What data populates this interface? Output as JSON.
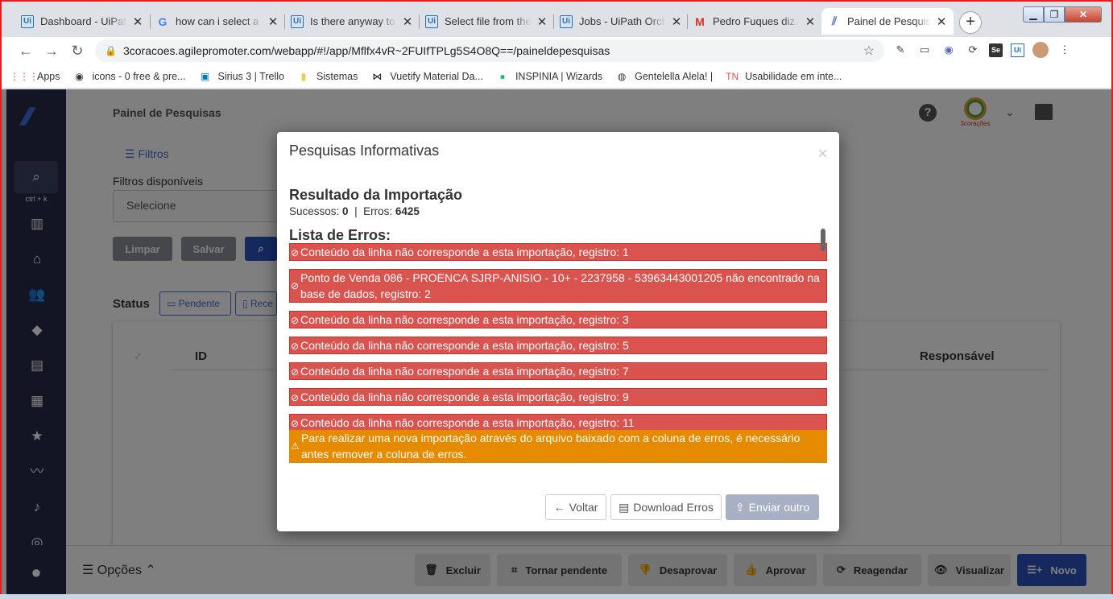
{
  "browser": {
    "tabs": [
      {
        "title": "Dashboard - UiPath",
        "icon": "uipath-icon",
        "fav": "Ui"
      },
      {
        "title": "how can i select a s",
        "icon": "google-icon",
        "fav": "G"
      },
      {
        "title": "Is there anyway to",
        "icon": "uipath-icon",
        "fav": "Ui"
      },
      {
        "title": "Select file from the",
        "icon": "uipath-icon",
        "fav": "Ui"
      },
      {
        "title": "Jobs - UiPath Orche",
        "icon": "uipath-icon",
        "fav": "Ui"
      },
      {
        "title": "Pedro Fuques diz...",
        "icon": "gmail-icon",
        "fav": "M"
      },
      {
        "title": "Painel de Pesquisas",
        "icon": "app-icon",
        "fav": "⫽"
      }
    ],
    "url": "3coracoes.agilepromoter.com/webapp/#!/app/Mflfx4vR~2FUIfTPLg5S4O8Q==/paineldepesquisas",
    "bookmarks": [
      {
        "label": "Apps",
        "icon": "apps-grid-icon",
        "glyph": "⋮⋮⋮"
      },
      {
        "label": "icons - 0 free & pre...",
        "icon": "icons-site-icon",
        "glyph": "◉"
      },
      {
        "label": "Sirius 3 | Trello",
        "icon": "trello-icon",
        "glyph": "▣"
      },
      {
        "label": "Sistemas",
        "icon": "folder-icon",
        "glyph": "▮"
      },
      {
        "label": "Vuetify Material Da...",
        "icon": "bowtie-icon",
        "glyph": "⋈"
      },
      {
        "label": "INSPINIA | Wizards",
        "icon": "inspinia-icon",
        "glyph": "●"
      },
      {
        "label": "Gentelella Alela! |",
        "icon": "gentelella-icon",
        "glyph": "◍"
      },
      {
        "label": "Usabilidade em inte...",
        "icon": "tn-icon",
        "glyph": "TN"
      }
    ]
  },
  "app": {
    "page_title": "Painel de Pesquisas",
    "shortcut_hint": "ctrl + k",
    "brand": "3corações",
    "filters_label": "Filtros",
    "filters_available_label": "Filtros disponíveis",
    "select_placeholder": "Selecione",
    "clear_label": "Limpar",
    "save_label": "Salvar",
    "status_label": "Status",
    "status_chips": [
      "Pendente",
      "Rece"
    ],
    "table_headers": {
      "id": "ID",
      "owner": "Responsável"
    },
    "options_label": "Opções",
    "actions": [
      "Excluir",
      "Tornar pendente",
      "Desaprovar",
      "Aprovar",
      "Reagendar",
      "Visualizar",
      "Novo"
    ]
  },
  "modal": {
    "title": "Pesquisas Informativas",
    "result_title": "Resultado da Importação",
    "success_label": "Sucessos:",
    "success_count": "0",
    "errors_label": "Erros:",
    "errors_count": "6425",
    "list_title": "Lista de Erros:",
    "errors": [
      "Conteúdo da linha não corresponde a esta importação, registro: 1",
      "Ponto de Venda 086 - PROENCA SJRP-ANISIO - 10+ - 2237958 - 53963443001205 não encontrado na base de dados, registro: 2",
      "Conteúdo da linha não corresponde a esta importação, registro: 3",
      "Conteúdo da linha não corresponde a esta importação, registro: 5",
      "Conteúdo da linha não corresponde a esta importação, registro: 7",
      "Conteúdo da linha não corresponde a esta importação, registro: 9",
      "Conteúdo da linha não corresponde a esta importação, registro: 11"
    ],
    "warning": "Para realizar uma nova importação através do arquivo baixado com a coluna de erros, é necessário antes remover a coluna de erros.",
    "back_label": "Voltar",
    "download_label": "Download Erros",
    "send_label": "Enviar outro"
  },
  "colors": {
    "error": "#d9534f",
    "warning": "#e68a00",
    "nav": "#272b4a",
    "primary": "#2a52be"
  }
}
